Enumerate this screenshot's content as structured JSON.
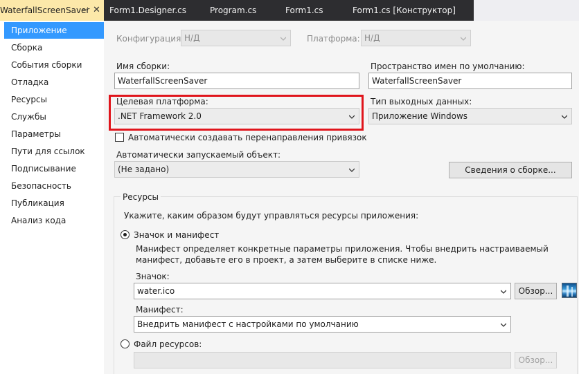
{
  "tabs": [
    {
      "label": "WaterfallScreenSaver",
      "pin": "⊣",
      "close": "✕"
    },
    {
      "label": "Form1.Designer.cs"
    },
    {
      "label": "Program.cs"
    },
    {
      "label": "Form1.cs"
    },
    {
      "label": "Form1.cs [Конструктор]"
    }
  ],
  "sidebar": {
    "items": [
      {
        "label": "Приложение"
      },
      {
        "label": "Сборка"
      },
      {
        "label": "События сборки"
      },
      {
        "label": "Отладка"
      },
      {
        "label": "Ресурсы"
      },
      {
        "label": "Службы"
      },
      {
        "label": "Параметры"
      },
      {
        "label": "Пути для ссылок"
      },
      {
        "label": "Подписывание"
      },
      {
        "label": "Безопасность"
      },
      {
        "label": "Публикация"
      },
      {
        "label": "Анализ кода"
      }
    ]
  },
  "config": {
    "configuration_label": "Конфигурация:",
    "configuration_value": "Н/Д",
    "platform_label": "Платформа:",
    "platform_value": "Н/Д"
  },
  "assembly": {
    "name_label": "Имя сборки:",
    "name_value": "WaterfallScreenSaver",
    "namespace_label": "Пространство имен по умолчанию:",
    "namespace_value": "WaterfallScreenSaver"
  },
  "target": {
    "framework_label": "Целевая платформа:",
    "framework_value": ".NET Framework 2.0",
    "output_label": "Тип выходных данных:",
    "output_value": "Приложение Windows"
  },
  "redirects_checkbox_label": "Автоматически создавать перенаправления привязок",
  "startup": {
    "label": "Автоматически запускаемый объект:",
    "value": "(Не задано)",
    "assembly_info_button": "Сведения о сборке..."
  },
  "resources": {
    "group_title": "Ресурсы",
    "hint": "Укажите, каким образом будут управляться ресурсы приложения:",
    "icon_manifest_radio": "Значок и манифест",
    "description_line1": "Манифест определяет конкретные параметры приложения. Чтобы внедрить настраиваемый",
    "description_line2": "манифест, добавьте его в проект, а затем выберите в списке ниже.",
    "icon_label": "Значок:",
    "icon_value": "water.ico",
    "browse_button": "Обзор...",
    "manifest_label": "Манифест:",
    "manifest_value": "Внедрить манифест с настройками по умолчанию",
    "resource_file_radio": "Файл ресурсов:",
    "resource_file_value": "",
    "browse_button_disabled": "Обзор..."
  },
  "colors": {
    "accent": "#3399ff",
    "highlight_box": "#e0151c",
    "active_tab": "#fce8a9",
    "dark_tab_bar": "#2d2d30"
  }
}
